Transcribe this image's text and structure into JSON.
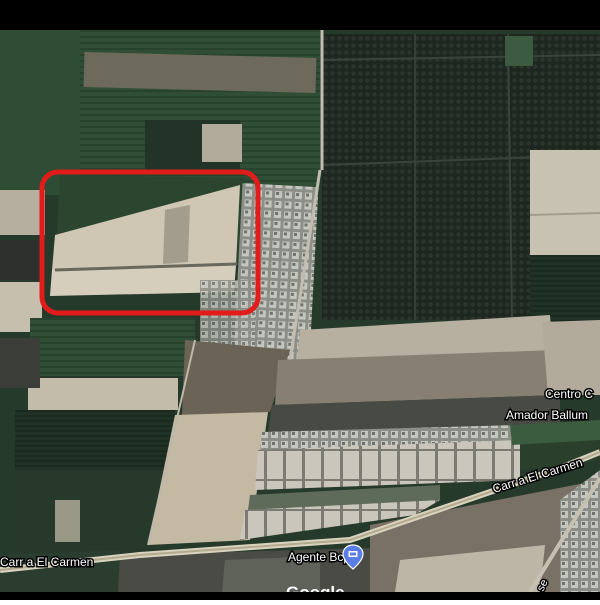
{
  "map": {
    "type": "satellite",
    "labels": {
      "road_west": "Carr a El Carmen",
      "road_east": "Carr a El Carmen",
      "place_line1": "Centro C",
      "place_line2": "Amador Ballum",
      "poi": "Agente Bcp",
      "watermark": "Google",
      "side_road_fragment": "se"
    },
    "highlight": {
      "shape": "rounded-rectangle",
      "color": "#e21b1b"
    },
    "colors": {
      "frame": "#000000",
      "field_dark": "#1f2a22",
      "orchard": "#232b25",
      "field_green": "#2c4a32",
      "bare_soil": "#c9bfae",
      "road": "#b9b4a6",
      "label_text": "#ffffff",
      "poi_pin": "#5b7de6"
    },
    "icons": {
      "poi": "bank-pin-icon"
    }
  }
}
